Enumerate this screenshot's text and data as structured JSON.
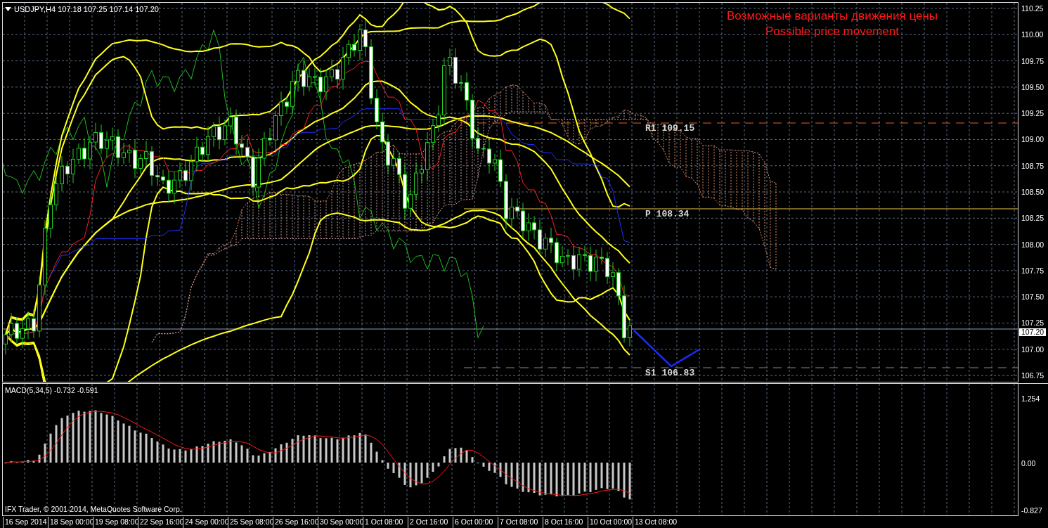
{
  "chart_header": {
    "title": "USDJPY,H4 107.18 107.25 107.14 107.20"
  },
  "forecast_title": [
    "Возможные варианты движения цены",
    "Possible price movement"
  ],
  "levels": [
    {
      "label": "R1 109.15",
      "kind": "resistance"
    },
    {
      "label": "P 108.34",
      "kind": "pivot"
    },
    {
      "label": "S1 106.83",
      "kind": "support"
    }
  ],
  "price_axis": {
    "ticks": [
      "110.25",
      "110.00",
      "109.75",
      "109.50",
      "109.25",
      "109.00",
      "108.75",
      "108.50",
      "108.25",
      "108.00",
      "107.75",
      "107.50",
      "107.25",
      "107.00",
      "106.75"
    ],
    "current_price": "107.20"
  },
  "macd": {
    "label": "MACD(5,34,5) -0.732 -0.591",
    "ticks": [
      "1.254",
      "0.00",
      "-0.827"
    ]
  },
  "copyright": "IFX Trader, © 2001-2014, MetaQuotes Software Corp.",
  "time_axis": [
    "16 Sep 2014",
    "18 Sep 00:00",
    "19 Sep 08:00",
    "22 Sep 16:00",
    "24 Sep 00:00",
    "25 Sep 08:00",
    "26 Sep 16:00",
    "30 Sep 00:00",
    "1 Oct 08:00",
    "2 Oct 16:00",
    "6 Oct 00:00",
    "7 Oct 08:00",
    "8 Oct 16:00",
    "10 Oct 00:00",
    "13 Oct 08:00"
  ]
}
